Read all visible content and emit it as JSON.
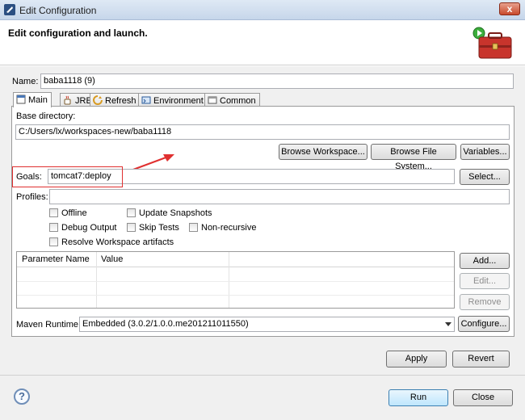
{
  "window": {
    "title": "Edit Configuration",
    "close_label": "x"
  },
  "header": {
    "title": "Edit configuration and launch."
  },
  "name_field": {
    "label": "Name:",
    "value": "baba1118 (9)"
  },
  "tabs": [
    {
      "label": "Main",
      "icon": "main-tab-icon",
      "active": true
    },
    {
      "label": "JRE",
      "icon": "jre-icon"
    },
    {
      "label": "Refresh",
      "icon": "refresh-icon"
    },
    {
      "label": "Environment",
      "icon": "environment-icon"
    },
    {
      "label": "Common",
      "icon": "common-icon"
    }
  ],
  "base_directory": {
    "label": "Base directory:",
    "value": "C:/Users/lx/workspaces-new/baba1118",
    "browse_workspace": "Browse Workspace...",
    "browse_file_system": "Browse File System...",
    "variables": "Variables..."
  },
  "goals": {
    "label": "Goals:",
    "value": "tomcat7:deploy",
    "select": "Select..."
  },
  "profiles": {
    "label": "Profiles:",
    "value": ""
  },
  "options": {
    "offline": "Offline",
    "update_snapshots": "Update Snapshots",
    "debug_output": "Debug Output",
    "skip_tests": "Skip Tests",
    "non_recursive": "Non-recursive",
    "resolve_workspace": "Resolve Workspace artifacts"
  },
  "parameters": {
    "col_name": "Parameter Name",
    "col_value": "Value",
    "add": "Add...",
    "edit": "Edit...",
    "remove": "Remove"
  },
  "runtime": {
    "label": "Maven Runtime:",
    "value": "Embedded (3.0.2/1.0.0.me201211011550)",
    "configure": "Configure..."
  },
  "actions": {
    "apply": "Apply",
    "revert": "Revert",
    "run": "Run",
    "close": "Close",
    "help": "?"
  },
  "colors": {
    "annotation": "#e03030"
  }
}
